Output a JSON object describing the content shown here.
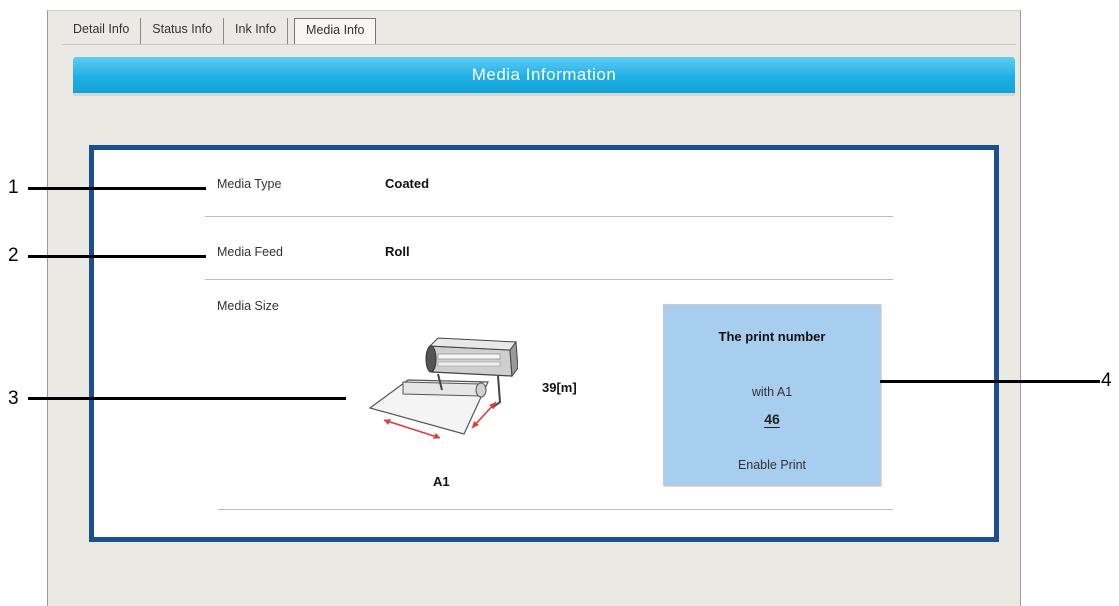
{
  "tabs": [
    {
      "label": "Detail Info"
    },
    {
      "label": "Status Info"
    },
    {
      "label": "Ink Info"
    },
    {
      "label": "Media Info",
      "active": true
    }
  ],
  "header": {
    "title": "Media Information"
  },
  "media": {
    "type_label": "Media Type",
    "type_value": "Coated",
    "feed_label": "Media Feed",
    "feed_value": "Roll",
    "size_label": "Media Size",
    "size_value": "A1",
    "remaining": "39[m]"
  },
  "print_box": {
    "title": "The print number",
    "with_label": "with A1",
    "number": "46",
    "enable_label": "Enable Print"
  },
  "callouts": [
    "1",
    "2",
    "3",
    "4"
  ],
  "colors": {
    "header_bar": "#1eb0e6",
    "frame_border": "#1c4f91",
    "print_box_bg": "#a7cdef",
    "panel_bg": "#ebe9e4"
  },
  "icons": {
    "printer": "roll-printer-icon"
  }
}
